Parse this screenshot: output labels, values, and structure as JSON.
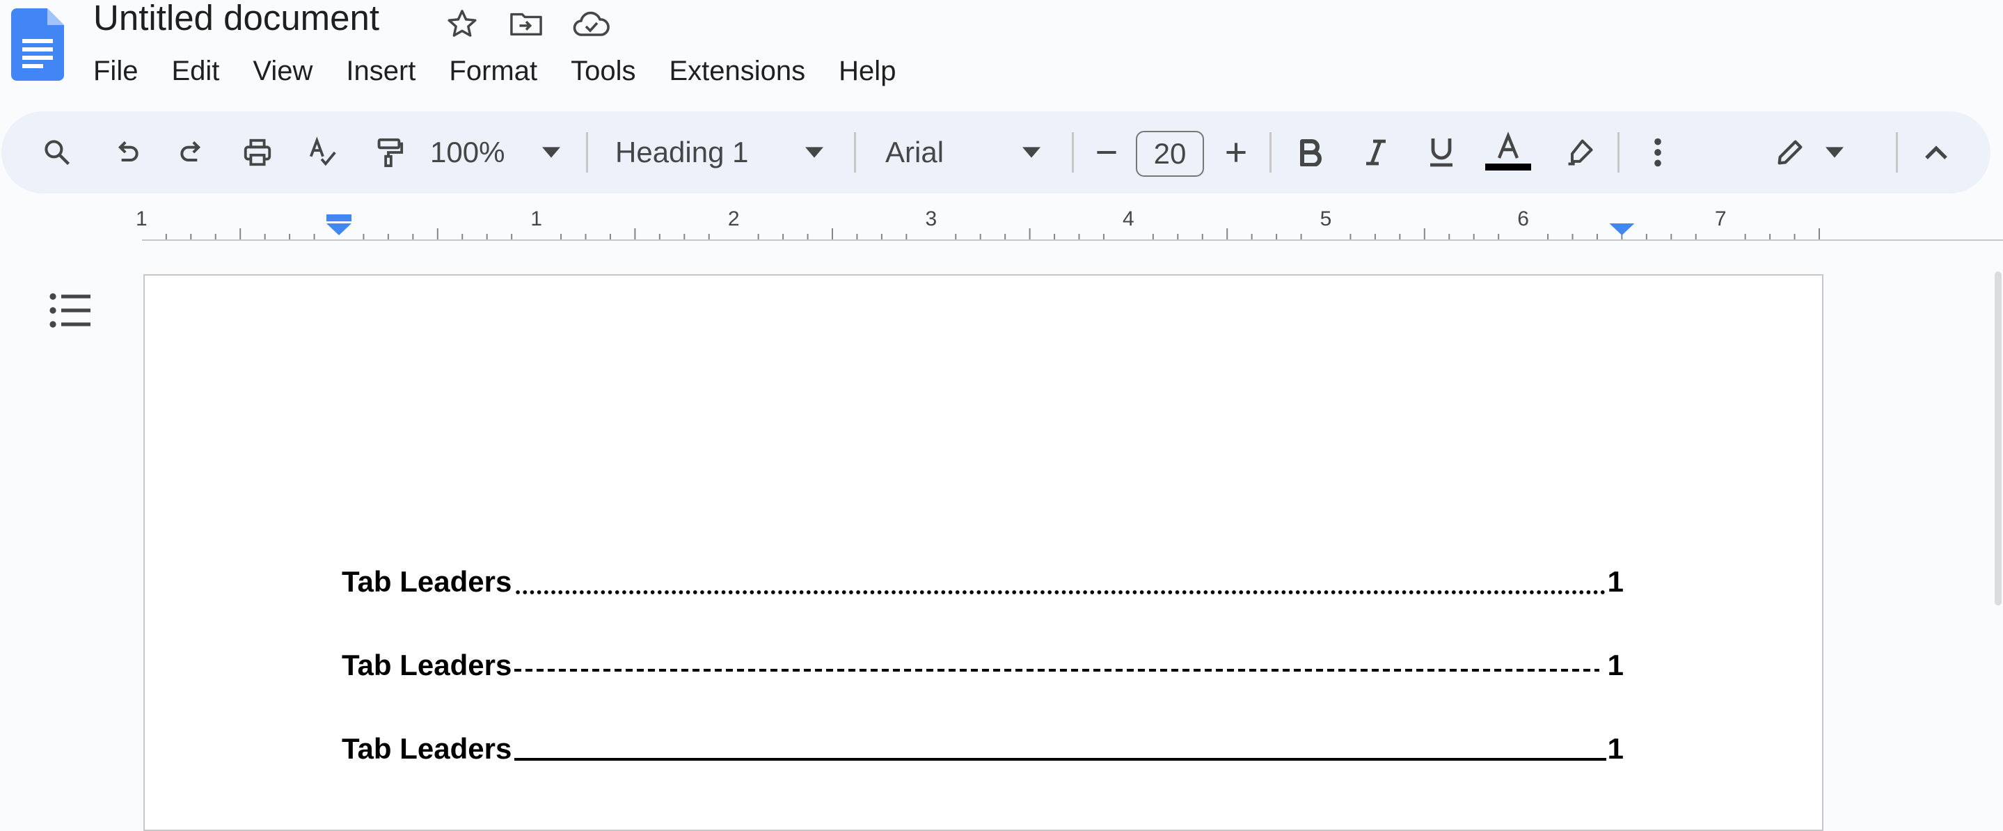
{
  "header": {
    "title": "Untitled document",
    "icons": [
      "docs-logo",
      "star-icon",
      "move-folder-icon",
      "cloud-saved-icon"
    ]
  },
  "menubar": [
    "File",
    "Edit",
    "View",
    "Insert",
    "Format",
    "Tools",
    "Extensions",
    "Help"
  ],
  "toolbar": {
    "zoom": "100%",
    "style": "Heading 1",
    "font": "Arial",
    "font_size": "20",
    "text_color": "#000000",
    "accent": "#4285f4",
    "icons": [
      "search-icon",
      "undo-icon",
      "redo-icon",
      "print-icon",
      "spellcheck-icon",
      "paint-format-icon",
      "decrease-font-icon",
      "increase-font-icon",
      "bold-icon",
      "italic-icon",
      "underline-icon",
      "text-color-icon",
      "highlight-icon",
      "more-icon",
      "editing-mode-icon",
      "collapse-icon"
    ]
  },
  "ruler": {
    "labels": [
      "1",
      "1",
      "2",
      "3",
      "4",
      "5",
      "6",
      "7"
    ]
  },
  "document": {
    "lines": [
      {
        "label": "Tab Leaders",
        "leader": "dots",
        "page": "1"
      },
      {
        "label": "Tab Leaders",
        "leader": "dashes",
        "page": "1"
      },
      {
        "label": "Tab Leaders",
        "leader": "underline",
        "page": "1"
      }
    ]
  }
}
